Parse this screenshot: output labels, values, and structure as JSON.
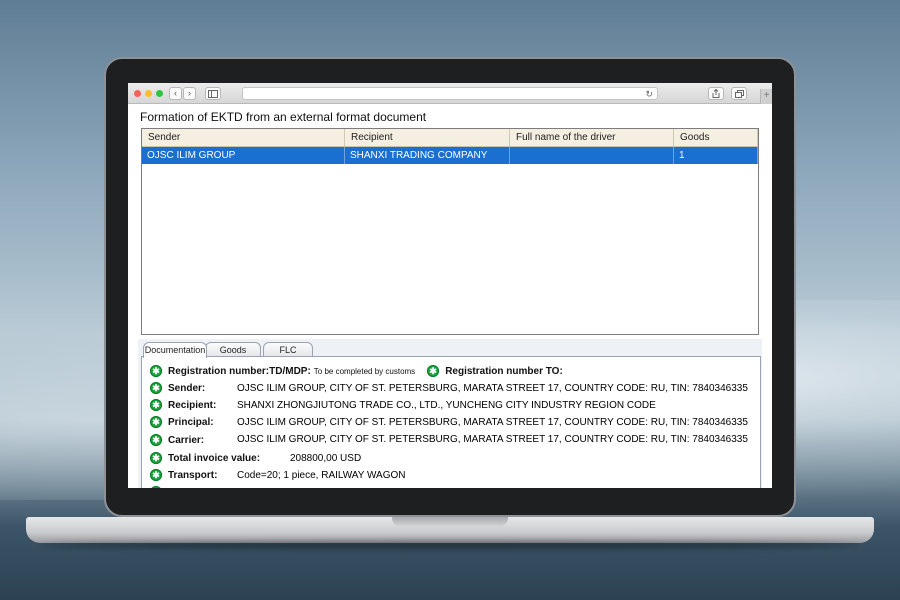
{
  "browser": {
    "back_glyph": "‹",
    "forward_glyph": "›",
    "reload_glyph": "↻",
    "plus_glyph": "+",
    "icons": [
      "sidebar-icon",
      "share-icon",
      "tabs-icon"
    ]
  },
  "app": {
    "title": "Formation of EKTD from an external format document"
  },
  "grid": {
    "columns": [
      "Sender",
      "Recipient",
      "Full name of the driver",
      "Goods"
    ],
    "rows": [
      [
        "OJSC ILIM GROUP",
        "SHANXI TRADING COMPANY",
        "",
        "1"
      ]
    ],
    "selected_color": "#1a6fd1"
  },
  "tabs": [
    "Documentation",
    "Goods",
    "FLC"
  ],
  "details": {
    "reg_label": "Registration number:",
    "reg_td_label": "TD/MDP:",
    "reg_td_value": "To be completed by customs",
    "reg_to_label": "Registration number TO:",
    "sender_label": "Sender:",
    "sender_value": "OJSC ILIM GROUP, CITY OF ST. PETERSBURG, MARATA STREET 17, COUNTRY CODE: RU, TIN: 7840346335",
    "recipient_label": "Recipient:",
    "recipient_value": "SHANXI ZHONGJIUTONG TRADE CO., LTD., YUNCHENG CITY INDUSTRY REGION CODE",
    "principal_label": "Principal:",
    "principal_value": "OJSC ILIM GROUP, CITY OF ST. PETERSBURG, MARATA STREET 17, COUNTRY CODE: RU, TIN: 7840346335",
    "carrier_label": "Carrier:",
    "carrier_value": "OJSC ILIM GROUP, CITY OF ST. PETERSBURG, MARATA STREET 17, COUNTRY CODE: RU, TIN: 7840346335",
    "invoice_label": "Total invoice value:",
    "invoice_value": "208800,00 USD",
    "transport_label": "Transport:",
    "transport_value": "Code=20; 1 piece, RAILWAY WAGON",
    "ok_glyph": "✱",
    "ok_color": "#1aa33b"
  }
}
